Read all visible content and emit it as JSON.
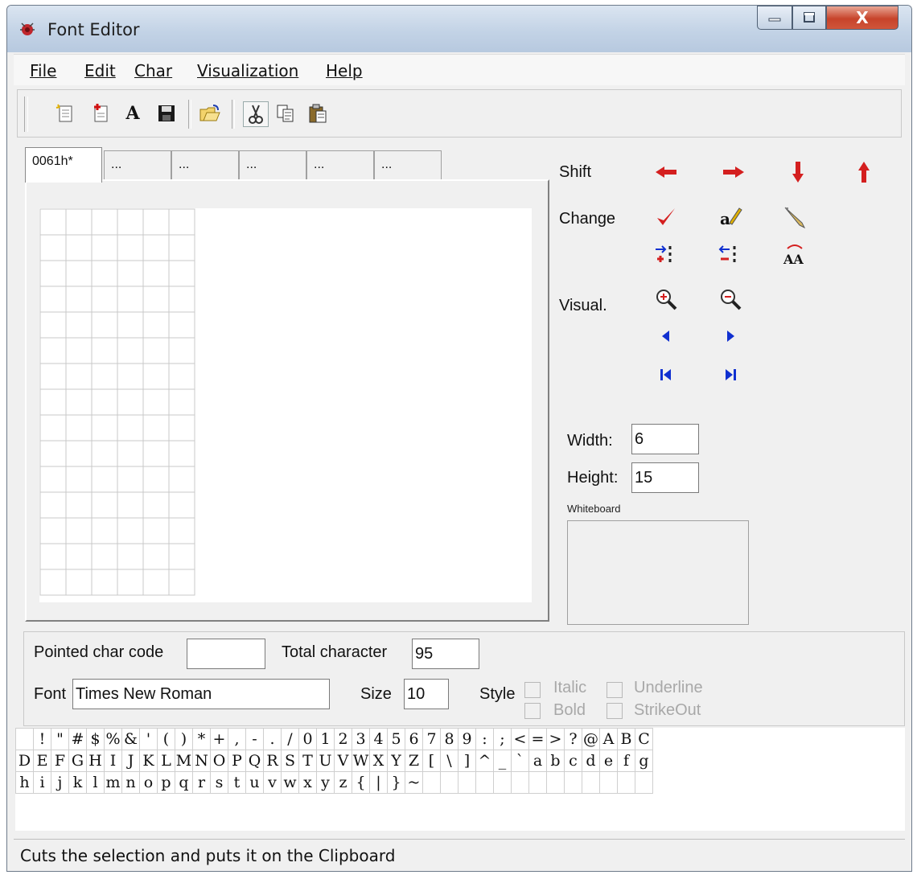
{
  "window": {
    "title": "Font Editor",
    "close_label": "X"
  },
  "menu": {
    "items": [
      {
        "label": "File"
      },
      {
        "label": "Edit"
      },
      {
        "label": "Char"
      },
      {
        "label": "Visualization"
      },
      {
        "label": "Help"
      }
    ]
  },
  "toolbar": {
    "buttons": [
      "new-icon",
      "new-from-font-icon",
      "font-icon",
      "save-icon",
      "open-icon",
      "cut-icon",
      "copy-icon",
      "paste-icon"
    ],
    "font_glyph": "A"
  },
  "tabs": [
    {
      "label": "0061h*"
    },
    {
      "label": "..."
    },
    {
      "label": "..."
    },
    {
      "label": "..."
    },
    {
      "label": "..."
    },
    {
      "label": "..."
    }
  ],
  "grid": {
    "cols": 6,
    "rows": 15
  },
  "sidebar": {
    "shift_label": "Shift",
    "change_label": "Change",
    "visual_label": "Visual.",
    "aa_glyph": "AA"
  },
  "dimensions": {
    "width_label": "Width:",
    "width_value": "6",
    "height_label": "Height:",
    "height_value": "15",
    "whiteboard_label": "Whiteboard"
  },
  "info": {
    "pointed_label": "Pointed char code",
    "pointed_value": "",
    "total_label": "Total character",
    "total_value": "95",
    "font_label": "Font",
    "font_value": "Times New Roman",
    "size_label": "Size",
    "size_value": "10",
    "style_label": "Style",
    "italic_label": "Italic",
    "bold_label": "Bold",
    "underline_label": "Underline",
    "strikeout_label": "StrikeOut"
  },
  "charmap": {
    "rows": [
      [
        " ",
        "!",
        "\"",
        "#",
        "$",
        "%",
        "&",
        "'",
        "(",
        ")",
        "*",
        "+",
        ",",
        "-",
        ".",
        "/",
        "0",
        "1",
        "2",
        "3",
        "4",
        "5",
        "6",
        "7",
        "8",
        "9",
        ":",
        ";",
        "<",
        "=",
        ">",
        "?",
        "@",
        "A",
        "B",
        "C"
      ],
      [
        "D",
        "E",
        "F",
        "G",
        "H",
        "I",
        "J",
        "K",
        "L",
        "M",
        "N",
        "O",
        "P",
        "Q",
        "R",
        "S",
        "T",
        "U",
        "V",
        "W",
        "X",
        "Y",
        "Z",
        "[",
        "\\",
        "]",
        "^",
        "_",
        "`",
        "a",
        "b",
        "c",
        "d",
        "e",
        "f",
        "g"
      ],
      [
        "h",
        "i",
        "j",
        "k",
        "l",
        "m",
        "n",
        "o",
        "p",
        "q",
        "r",
        "s",
        "t",
        "u",
        "v",
        "w",
        "x",
        "y",
        "z",
        "{",
        "|",
        "}",
        "~",
        "",
        "",
        "",
        "",
        "",
        "",
        "",
        "",
        "",
        "",
        "",
        "",
        ""
      ]
    ]
  },
  "status": {
    "text": "Cuts the selection and puts it on the Clipboard"
  },
  "colors": {
    "arrow_red": "#d41f1f",
    "nav_blue": "#1030d0",
    "grid_line": "#c8c8c8"
  }
}
